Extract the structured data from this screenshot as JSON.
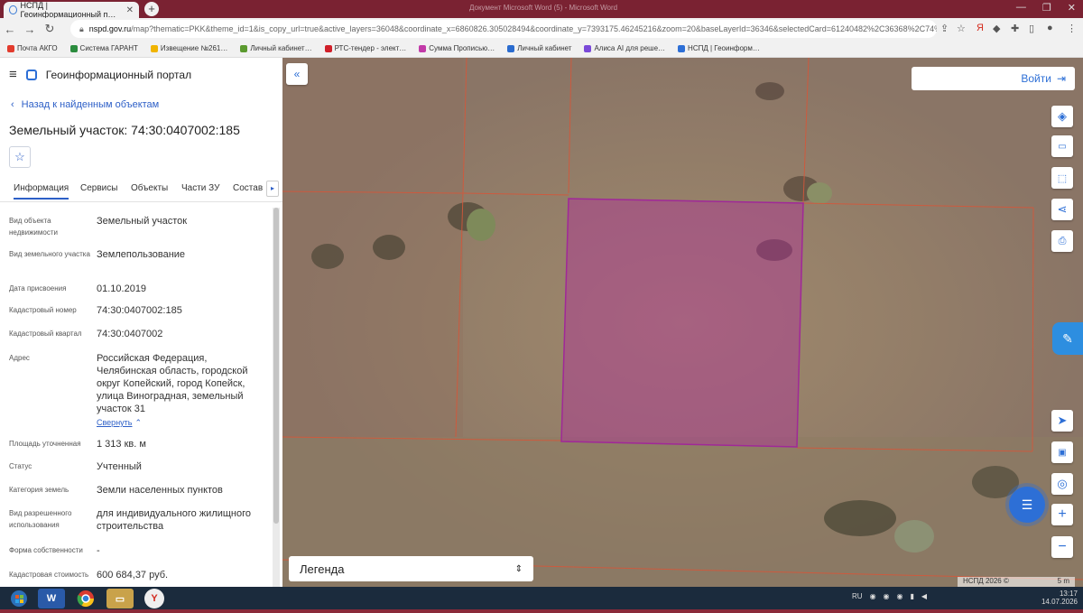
{
  "browser": {
    "tab_title": "НСПД | Геоинформационный п…",
    "window_title": "Документ Microsoft Word (5) - Microsoft Word",
    "url_domain": "nspd.gov.ru",
    "url_rest": "/map?thematic=PKK&theme_id=1&is_copy_url=true&active_layers=36048&coordinate_x=6860826.305028494&coordinate_y=7393175.46245216&zoom=20&baseLayerId=36346&selectedCard=61240482%2C36368%2C74%3A30…",
    "bookmarks": [
      {
        "label": "Почта АКГО",
        "color": "#e23b2d"
      },
      {
        "label": "Система ГАРАНТ",
        "color": "#2b8c3e"
      },
      {
        "label": "Извещение №261…",
        "color": "#f0b400"
      },
      {
        "label": "Личный кабинет…",
        "color": "#5b9a2f"
      },
      {
        "label": "РТС-тендер - элект…",
        "color": "#d0202a"
      },
      {
        "label": "Сумма Прописью…",
        "color": "#c23aa8"
      },
      {
        "label": "Личный кабинет",
        "color": "#2b6ccf"
      },
      {
        "label": "Алиса AI для реше…",
        "color": "#7a49d8"
      },
      {
        "label": "НСПД | Геоинформ…",
        "color": "#2d6fd6"
      }
    ]
  },
  "header": {
    "portal_name": "Геоинформационный портал",
    "back_link": "Назад к найденным объектам",
    "object_title": "Земельный участок: 74:30:0407002:185"
  },
  "tabs": [
    "Информация",
    "Сервисы",
    "Объекты",
    "Части ЗУ",
    "Состав"
  ],
  "info": [
    {
      "label": "Вид объекта недвижимости",
      "value": "Земельный участок"
    },
    {
      "label": "Вид земельного участка",
      "value": "Землепользование"
    },
    {
      "label": "Дата присвоения",
      "value": "01.10.2019"
    },
    {
      "label": "Кадастровый номер",
      "value": "74:30:0407002:185"
    },
    {
      "label": "Кадастровый квартал",
      "value": "74:30:0407002"
    },
    {
      "label": "Адрес",
      "value": "Российская Федерация, Челябинская область, городской округ Копейский, город Копейск, улица Виноградная, земельный участок 31"
    },
    {
      "label": "Площадь уточненная",
      "value": "1 313 кв. м"
    },
    {
      "label": "Статус",
      "value": "Учтенный"
    },
    {
      "label": "Категория земель",
      "value": "Земли населенных пунктов"
    },
    {
      "label": "Вид разрешенного использования",
      "value": "для индивидуального жилищного строительства"
    },
    {
      "label": "Форма собственности",
      "value": "-"
    },
    {
      "label": "Кадастровая стоимость",
      "value": "600 684,37 руб."
    }
  ],
  "collapse_label": "Свернуть",
  "map": {
    "login_label": "Войти",
    "legend_label": "Легенда",
    "copyright": "НСПД 2026 ©",
    "scale": "5 m",
    "parcel_color": "#b0309a"
  },
  "taskbar": {
    "lang": "RU",
    "time": "13:17",
    "date": "14.07.2026"
  }
}
